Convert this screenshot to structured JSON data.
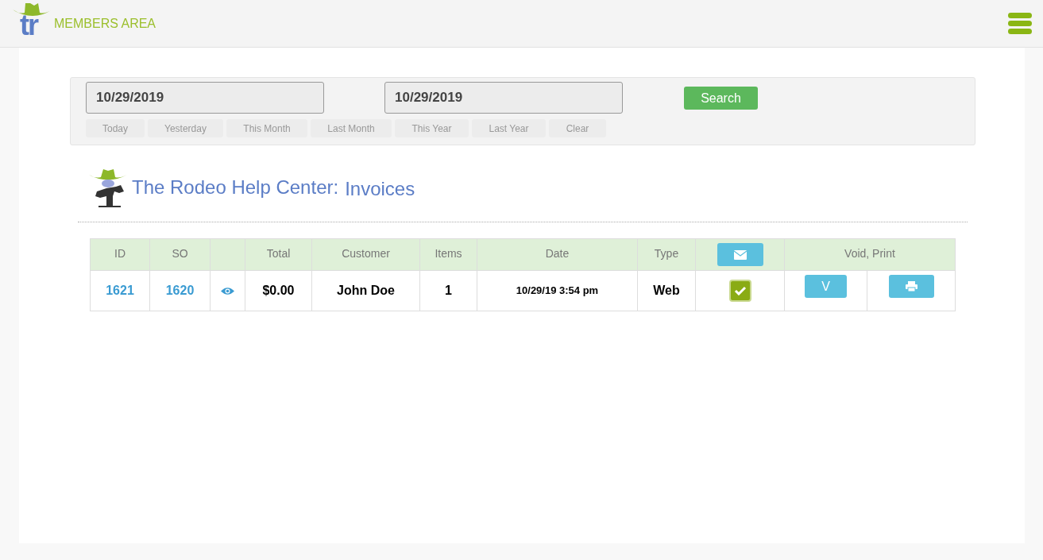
{
  "header": {
    "logo_text": "tr",
    "title": "MEMBERS AREA"
  },
  "filter": {
    "date_from": "10/29/2019",
    "date_to": "10/29/2019",
    "search_button": "Search",
    "quick_ranges": [
      "Today",
      "Yesterday",
      "This Month",
      "Last Month",
      "This Year",
      "Last Year",
      "Clear"
    ]
  },
  "page_title": {
    "site": "The Rodeo Help Center:",
    "section": "Invoices"
  },
  "table": {
    "columns": [
      {
        "kind": "text",
        "label": "ID"
      },
      {
        "kind": "text",
        "label": "SO"
      },
      {
        "kind": "blank"
      },
      {
        "kind": "text",
        "label": "Total"
      },
      {
        "kind": "text",
        "label": "Customer"
      },
      {
        "kind": "text",
        "label": "Items"
      },
      {
        "kind": "text",
        "label": "Date"
      },
      {
        "kind": "text",
        "label": "Type"
      },
      {
        "kind": "mail"
      },
      {
        "kind": "wide",
        "label": "Void, Print"
      }
    ],
    "rows": [
      {
        "id": "1621",
        "so": "1620",
        "total": "$0.00",
        "customer": "John Doe",
        "items": "1",
        "date": "10/29/19 3:54 pm",
        "type": "Web",
        "emailed": true,
        "void_button": "V"
      }
    ]
  }
}
